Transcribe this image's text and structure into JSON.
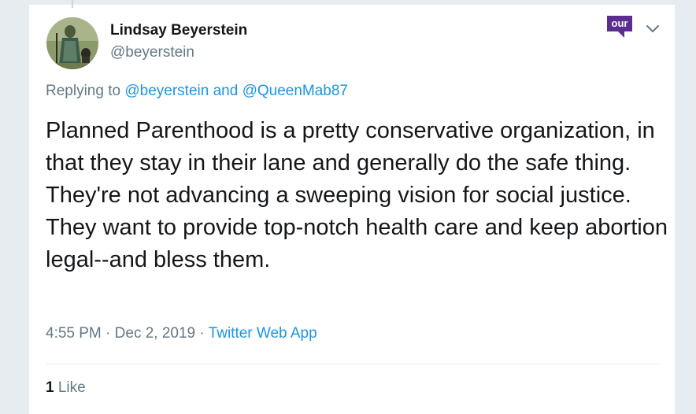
{
  "tweet": {
    "author": {
      "display_name": "Lindsay Beyerstein",
      "handle": "@beyerstein"
    },
    "badge": {
      "label": "our",
      "color": "#5c2d91"
    },
    "reply_prefix": "Replying to",
    "reply_user_1": "@beyerstein",
    "reply_and": "and",
    "reply_user_2": "@QueenMab87",
    "text": "Planned Parenthood is a pretty conservative organization, in that they stay in their lane and generally do the safe thing. They're not advancing a sweeping vision for social justice. They want to provide top-notch health care and keep abortion legal--and bless them.",
    "time": "4:55 PM",
    "separator": "·",
    "date": "Dec 2, 2019",
    "source": "Twitter Web App",
    "like_count": "1",
    "like_label": "Like"
  },
  "icons": {
    "caret": "chevron-down-icon",
    "avatar": "avatar-image"
  },
  "colors": {
    "link": "#1b95e0",
    "secondary_text": "#657786",
    "primary_text": "#14171a"
  }
}
